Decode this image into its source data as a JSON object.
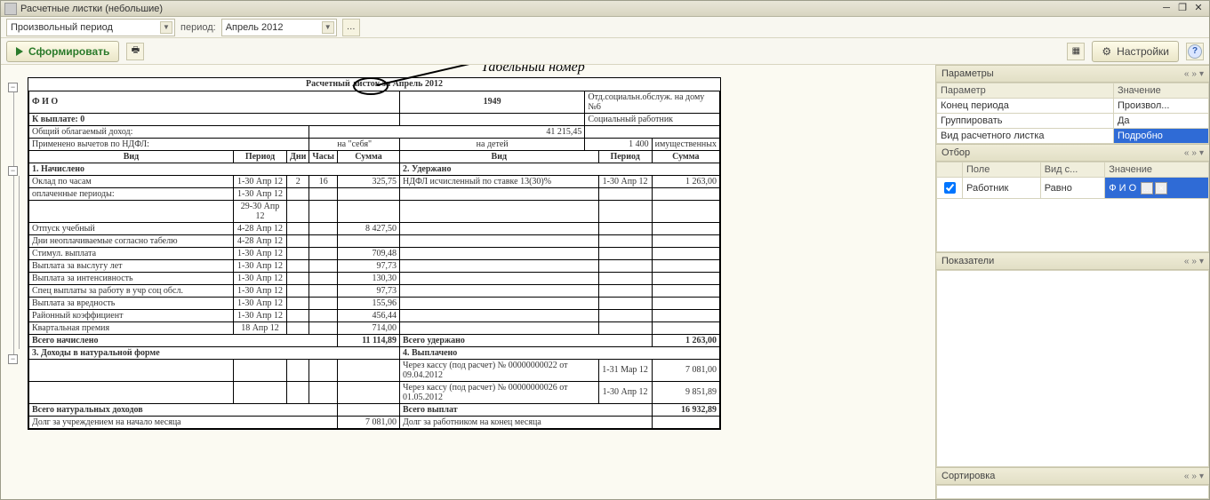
{
  "window": {
    "title": "Расчетные листки (небольшие)"
  },
  "toolbar": {
    "period_type": "Произвольный период",
    "period_label": "период:",
    "period_value": "Апрель 2012",
    "generate": "Сформировать",
    "settings": "Настройки"
  },
  "annotation": {
    "label": "Табельный номер"
  },
  "report": {
    "title": "Расчетный листок за Апрель 2012",
    "fio_label": "Ф И О",
    "tab_number": "1949",
    "dept": "Отд.социальн.обслуж. на дому №6",
    "to_pay": "К выплате: 0",
    "position": "Социальный работник",
    "income_row": {
      "label": "Общий облагаемый доход:",
      "value": "41 215,45"
    },
    "ndfl_row": {
      "label": "Применено вычетов по НДФЛ:",
      "self": "на \"себя\"",
      "kids": "на детей",
      "val": "1 400",
      "prop": "имущественных"
    },
    "headers": {
      "kind": "Вид",
      "period": "Период",
      "days": "Дни",
      "hours": "Часы",
      "sum": "Сумма"
    },
    "sections": {
      "s1": "1. Начислено",
      "s2": "2. Удержано",
      "s3": "3. Доходы в натуральной форме",
      "s4": "4. Выплачено"
    },
    "accruals": [
      {
        "name": "Оклад по часам",
        "period": "1-30 Апр 12",
        "days": "2",
        "hours": "16",
        "sum": "325,75",
        "r_name": "НДФЛ исчисленный по ставке 13(30)%",
        "r_period": "1-30 Апр 12",
        "r_sum": "1 263,00"
      },
      {
        "name": "   оплаченные периоды:",
        "period": "1-30 Апр 12",
        "days": "",
        "hours": "",
        "sum": "",
        "r_name": "",
        "r_period": "",
        "r_sum": ""
      },
      {
        "name": "",
        "period": "29-30 Апр 12",
        "days": "",
        "hours": "",
        "sum": "",
        "r_name": "",
        "r_period": "",
        "r_sum": ""
      },
      {
        "name": "Отпуск учебный",
        "period": "4-28 Апр 12",
        "days": "",
        "hours": "",
        "sum": "8 427,50",
        "r_name": "",
        "r_period": "",
        "r_sum": ""
      },
      {
        "name": "Дни неоплачиваемые согласно табелю",
        "period": "4-28 Апр 12",
        "days": "",
        "hours": "",
        "sum": "",
        "r_name": "",
        "r_period": "",
        "r_sum": ""
      },
      {
        "name": "Стимул. выплата",
        "period": "1-30 Апр 12",
        "days": "",
        "hours": "",
        "sum": "709,48",
        "r_name": "",
        "r_period": "",
        "r_sum": ""
      },
      {
        "name": "Выплата за выслугу лет",
        "period": "1-30 Апр 12",
        "days": "",
        "hours": "",
        "sum": "97,73",
        "r_name": "",
        "r_period": "",
        "r_sum": ""
      },
      {
        "name": "Выплата за интенсивность",
        "period": "1-30 Апр 12",
        "days": "",
        "hours": "",
        "sum": "130,30",
        "r_name": "",
        "r_period": "",
        "r_sum": ""
      },
      {
        "name": "Спец выплаты за работу в учр соц обсл.",
        "period": "1-30 Апр 12",
        "days": "",
        "hours": "",
        "sum": "97,73",
        "r_name": "",
        "r_period": "",
        "r_sum": ""
      },
      {
        "name": "Выплата за вредность",
        "period": "1-30 Апр 12",
        "days": "",
        "hours": "",
        "sum": "155,96",
        "r_name": "",
        "r_period": "",
        "r_sum": ""
      },
      {
        "name": "Районный коэффициент",
        "period": "1-30 Апр 12",
        "days": "",
        "hours": "",
        "sum": "456,44",
        "r_name": "",
        "r_period": "",
        "r_sum": ""
      },
      {
        "name": "Квартальная премия",
        "period": "18 Апр 12",
        "days": "",
        "hours": "",
        "sum": "714,00",
        "r_name": "",
        "r_period": "",
        "r_sum": ""
      }
    ],
    "payments": [
      {
        "name": "",
        "period": "",
        "sum": "",
        "r_name": "Через кассу (под расчет) № 00000000022 от 09.04.2012",
        "r_period": "1-31 Мар 12",
        "r_sum": "7 081,00"
      },
      {
        "name": "",
        "period": "",
        "sum": "",
        "r_name": "Через кассу (под расчет) № 00000000026 от 01.05.2012",
        "r_period": "1-30 Апр 12",
        "r_sum": "9 851,89"
      }
    ],
    "totals": {
      "accrued_l": "Всего начислено",
      "accrued": "11 114,89",
      "deducted_l": "Всего удержано",
      "deducted": "1 263,00",
      "natural_l": "Всего натуральных доходов",
      "paid_l": "Всего выплат",
      "paid": "16 932,89"
    },
    "debts": {
      "org_l": "Долг за учреждением на начало месяца",
      "org": "7 081,00",
      "emp_l": "Долг за работником на конец месяца"
    }
  },
  "panels": {
    "params": "Параметры",
    "filter": "Отбор",
    "indicators": "Показатели",
    "sort": "Сортировка",
    "col_param": "Параметр",
    "col_value": "Значение",
    "col_field": "Поле",
    "col_cond": "Вид с..."
  },
  "params": [
    {
      "name": "Конец периода",
      "value": "Произвол...",
      "sel": false
    },
    {
      "name": "Группировать",
      "value": "Да",
      "sel": false
    },
    {
      "name": "Вид расчетного листка",
      "value": "Подробно",
      "sel": true
    }
  ],
  "filters": [
    {
      "checked": true,
      "field": "Работник",
      "cond": "Равно",
      "value": "Ф И О",
      "sel": true
    }
  ]
}
